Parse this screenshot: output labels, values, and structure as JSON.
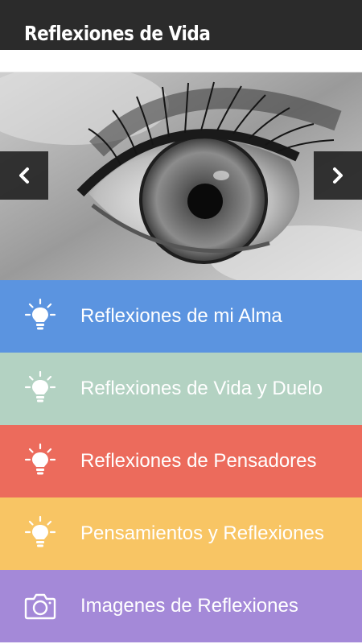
{
  "header": {
    "title": "Reflexiones de Vida"
  },
  "colors": {
    "header_bg": "#2b2b2b",
    "item_1": "#5b94e0",
    "item_2": "#b3d2c2",
    "item_3": "#ec6b5c",
    "item_4": "#f8c564",
    "item_5": "#a489d8"
  },
  "slider": {
    "prev_icon": "chevron-left-icon",
    "next_icon": "chevron-right-icon"
  },
  "menu": {
    "items": [
      {
        "label": "Reflexiones de mi Alma",
        "icon": "lightbulb-icon"
      },
      {
        "label": "Reflexiones de Vida y Duelo",
        "icon": "lightbulb-icon"
      },
      {
        "label": "Reflexiones de Pensadores",
        "icon": "lightbulb-icon"
      },
      {
        "label": "Pensamientos y Reflexiones",
        "icon": "lightbulb-icon"
      },
      {
        "label": "Imagenes de Reflexiones",
        "icon": "camera-icon"
      }
    ]
  }
}
